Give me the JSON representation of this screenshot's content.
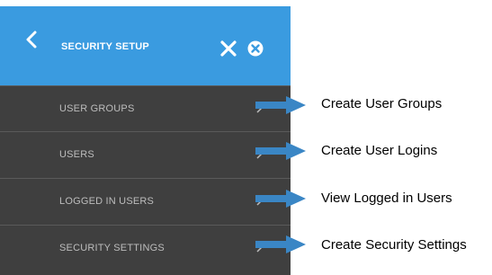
{
  "header": {
    "title": "SECURITY SETUP",
    "background_color": "#3a9be0",
    "icons": {
      "back": "chevron-left-icon",
      "close": "close-icon",
      "close_circle": "close-circle-icon"
    }
  },
  "menu": {
    "background_color": "#3f3f3f",
    "items": [
      {
        "label": "USER GROUPS",
        "icon": "chevron-right-icon"
      },
      {
        "label": "USERS",
        "icon": "chevron-right-icon"
      },
      {
        "label": "LOGGED IN USERS",
        "icon": "chevron-right-icon"
      },
      {
        "label": "SECURITY SETTINGS",
        "icon": "chevron-right-icon"
      }
    ]
  },
  "annotations": {
    "arrow_color": "#3a86c5",
    "items": [
      {
        "text": "Create User Groups"
      },
      {
        "text": "Create User Logins"
      },
      {
        "text": "View Logged in Users"
      },
      {
        "text": "Create Security Settings"
      }
    ]
  }
}
